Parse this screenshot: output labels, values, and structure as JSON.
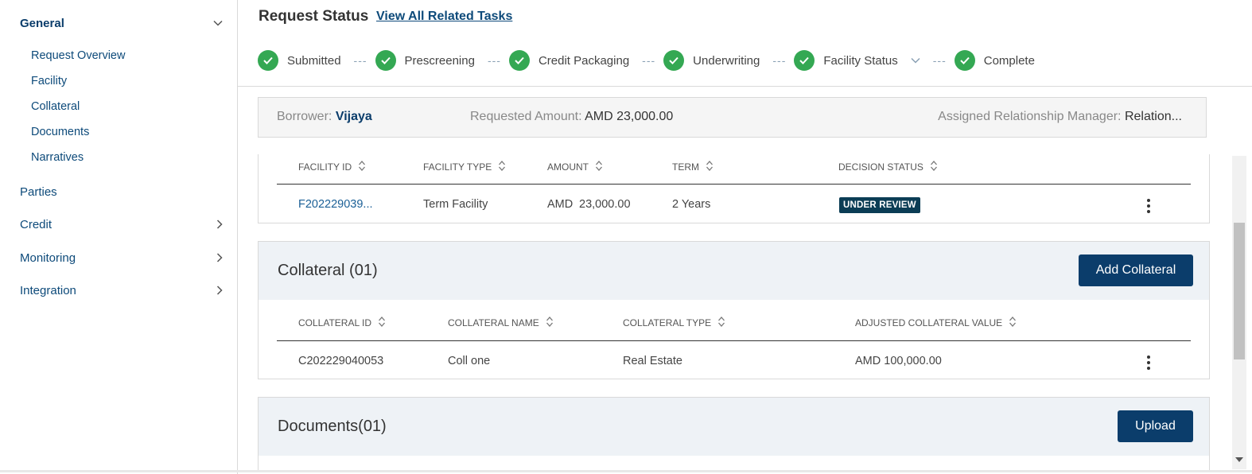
{
  "sidebar": {
    "general": "General",
    "general_items": [
      "Request Overview",
      "Facility",
      "Collateral",
      "Documents",
      "Narratives"
    ],
    "parties": "Parties",
    "credit": "Credit",
    "monitoring": "Monitoring",
    "integration": "Integration"
  },
  "status": {
    "title": "Request Status",
    "link": "View All Related Tasks",
    "steps": [
      "Submitted",
      "Prescreening",
      "Credit Packaging",
      "Underwriting",
      "Facility Status",
      "Complete"
    ],
    "dash": "---"
  },
  "summary": {
    "borrower_label": "Borrower:",
    "borrower_value": "Vijaya",
    "amount_label": "Requested Amount:",
    "amount_value": "AMD 23,000.00",
    "manager_label": "Assigned Relationship Manager:",
    "manager_value": "Relation..."
  },
  "facility_table": {
    "headers": [
      "FACILITY ID",
      "FACILITY TYPE",
      "AMOUNT",
      "TERM",
      "DECISION STATUS"
    ],
    "row": {
      "id": "F202229039...",
      "type": "Term Facility",
      "currency": "AMD",
      "amount": "23,000.00",
      "term": "2 Years",
      "status": "UNDER REVIEW"
    }
  },
  "collateral": {
    "title": "Collateral (01)",
    "button": "Add Collateral",
    "headers": [
      "COLLATERAL ID",
      "COLLATERAL NAME",
      "COLLATERAL TYPE",
      "ADJUSTED COLLATERAL VALUE"
    ],
    "row": {
      "id": "C202229040053",
      "name": "Coll one",
      "type": "Real Estate",
      "value": "AMD 100,000.00"
    }
  },
  "documents": {
    "title": "Documents(01)",
    "button": "Upload"
  },
  "colors": {
    "primary": "#0b3d6b",
    "link": "#0d4a7a",
    "success": "#34a853",
    "badge": "#0b3d55"
  }
}
